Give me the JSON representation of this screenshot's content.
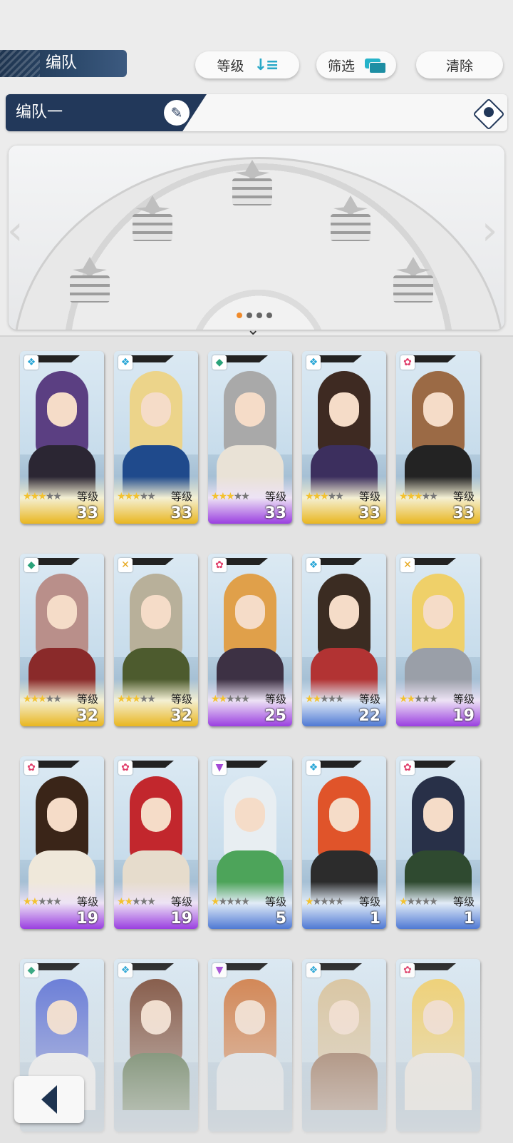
{
  "header": {
    "title": "编队",
    "sort_label": "等级",
    "filter_label": "筛选",
    "clear_label": "清除"
  },
  "team": {
    "name": "编队一"
  },
  "formation": {
    "page_count": 4,
    "current_page": 1
  },
  "level_label": "等级",
  "characters": [
    {
      "level": "33",
      "stars": 3,
      "rarity": "gold",
      "element": "❖",
      "elem_color": "#29a6d6",
      "hair": "#5b3f82",
      "outfit": "#2b2633"
    },
    {
      "level": "33",
      "stars": 3,
      "rarity": "gold",
      "element": "❖",
      "elem_color": "#29a6d6",
      "hair": "#ecd48a",
      "outfit": "#1f4a8c"
    },
    {
      "level": "33",
      "stars": 3,
      "rarity": "purple",
      "element": "◆",
      "elem_color": "#2aa37a",
      "hair": "#a9a9a9",
      "outfit": "#e9e2d6"
    },
    {
      "level": "33",
      "stars": 3,
      "rarity": "gold",
      "element": "❖",
      "elem_color": "#29a6d6",
      "hair": "#3e2a22",
      "outfit": "#3c2f5e"
    },
    {
      "level": "33",
      "stars": 3,
      "rarity": "gold",
      "element": "✿",
      "elem_color": "#e03e6a",
      "hair": "#9b6a45",
      "outfit": "#232323"
    },
    {
      "level": "32",
      "stars": 3,
      "rarity": "gold",
      "element": "◆",
      "elem_color": "#2aa37a",
      "hair": "#b98f8a",
      "outfit": "#8a2a2a"
    },
    {
      "level": "32",
      "stars": 3,
      "rarity": "gold",
      "element": "✕",
      "elem_color": "#e6a81e",
      "hair": "#b8b09a",
      "outfit": "#4d5b2e"
    },
    {
      "level": "25",
      "stars": 2,
      "rarity": "purple",
      "element": "✿",
      "elem_color": "#e03e6a",
      "hair": "#e0a04a",
      "outfit": "#3d3144"
    },
    {
      "level": "22",
      "stars": 2,
      "rarity": "blue",
      "element": "❖",
      "elem_color": "#29a6d6",
      "hair": "#3b2c22",
      "outfit": "#b23333"
    },
    {
      "level": "19",
      "stars": 2,
      "rarity": "purple",
      "element": "✕",
      "elem_color": "#e6a81e",
      "hair": "#efd069",
      "outfit": "#9a9fa8"
    },
    {
      "level": "19",
      "stars": 2,
      "rarity": "purple",
      "element": "✿",
      "elem_color": "#e03e6a",
      "hair": "#3a2518",
      "outfit": "#efe8da"
    },
    {
      "level": "19",
      "stars": 2,
      "rarity": "purple",
      "element": "✿",
      "elem_color": "#e03e6a",
      "hair": "#c2272d",
      "outfit": "#e6dccc"
    },
    {
      "level": "5",
      "stars": 1,
      "rarity": "blue",
      "element": "▼",
      "elem_color": "#a44ad6",
      "hair": "#e8eef2",
      "outfit": "#4da45a"
    },
    {
      "level": "1",
      "stars": 1,
      "rarity": "blue",
      "element": "❖",
      "elem_color": "#29a6d6",
      "hair": "#e0542a",
      "outfit": "#2c2c2c"
    },
    {
      "level": "1",
      "stars": 1,
      "rarity": "blue",
      "element": "✿",
      "elem_color": "#e03e6a",
      "hair": "#283048",
      "outfit": "#2f4a30"
    },
    {
      "level": "",
      "stars": 0,
      "rarity": "none",
      "element": "◆",
      "elem_color": "#2aa37a",
      "hair": "#5a70d6",
      "outfit": "#f2f2f2"
    },
    {
      "level": "",
      "stars": 0,
      "rarity": "none",
      "element": "❖",
      "elem_color": "#29a6d6",
      "hair": "#7a4a36",
      "outfit": "#3b5a2c"
    },
    {
      "level": "",
      "stars": 0,
      "rarity": "none",
      "element": "▼",
      "elem_color": "#a44ad6",
      "hair": "#d07a42",
      "outfit": "#dfe6ea"
    },
    {
      "level": "",
      "stars": 0,
      "rarity": "none",
      "element": "❖",
      "elem_color": "#29a6d6",
      "hair": "#d8c29a",
      "outfit": "#8a5a3a"
    },
    {
      "level": "",
      "stars": 0,
      "rarity": "none",
      "element": "✿",
      "elem_color": "#e03e6a",
      "hair": "#f0cf6a",
      "outfit": "#ece6dc"
    }
  ]
}
